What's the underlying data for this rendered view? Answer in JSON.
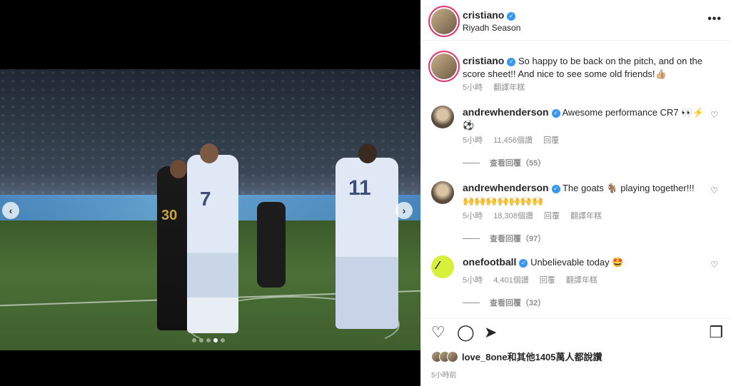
{
  "post": {
    "username": "cristiano",
    "location": "Riyadh Season",
    "more": "•••"
  },
  "caption": {
    "username": "cristiano",
    "text": "So happy to be back on the pitch, and on the score sheet!! And nice to see some old friends!👍🏼",
    "time": "5小時",
    "translate": "翻譯年糕"
  },
  "comments": [
    {
      "username": "andrewhenderson",
      "text": "Awesome performance CR7 👀⚡️⚽️",
      "time": "5小時",
      "likes": "11,456個讚",
      "reply": "回覆",
      "translate": "",
      "view_replies": "查看回覆（55）"
    },
    {
      "username": "andrewhenderson",
      "text": "The goats 🐐 playing together!!! 🙌🙌🙌🙌🙌🙌🙌",
      "time": "5小時",
      "likes": "18,308個讚",
      "reply": "回覆",
      "translate": "翻譯年糕",
      "view_replies": "查看回覆（97）"
    },
    {
      "username": "onefootball",
      "text": "Unbelievable today 🤩",
      "time": "5小時",
      "likes": "4,401個讚",
      "reply": "回覆",
      "translate": "翻譯年糕",
      "view_replies": "查看回覆（32）"
    }
  ],
  "likes_summary": "love_8one和其他1405萬人都說讚",
  "posted_time": "5小時前",
  "photo": {
    "jersey_numbers": [
      "7",
      "30",
      "11"
    ],
    "carousel_dots": 5,
    "active_dot": 4
  },
  "icons": {
    "heart": "heart-icon",
    "comment": "comment-icon",
    "share": "share-icon",
    "save": "bookmark-icon",
    "verified": "verified-badge-icon"
  }
}
